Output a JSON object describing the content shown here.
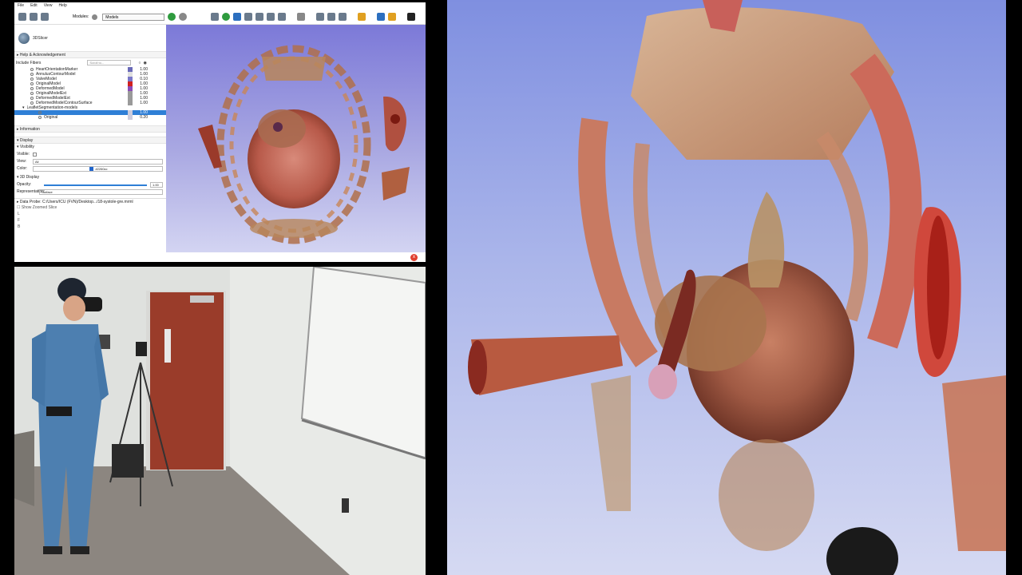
{
  "menu": [
    "File",
    "Edit",
    "View",
    "Help"
  ],
  "toolbar": {
    "modules_label": "Modules:",
    "module_selected": "Models"
  },
  "app": {
    "name": "3DSlicer"
  },
  "sections": {
    "help": "Help & Acknowledgement",
    "information": "Information",
    "display": "Display",
    "visibility": "Visibility",
    "display3d": "3D Display"
  },
  "filter": {
    "label": "Include Fibers",
    "placeholder": "Scroll to..."
  },
  "models": [
    {
      "name": "HeartOrientationMarker",
      "opacity": "1.00",
      "color": "#6a6ab8"
    },
    {
      "name": "AnnulusContourModel",
      "opacity": "1.00",
      "color": "#e0e0e0"
    },
    {
      "name": "ValveModel",
      "opacity": "0.10",
      "color": "#7a78c8"
    },
    {
      "name": "OriginalModel",
      "opacity": "1.00",
      "color": "#d02020"
    },
    {
      "name": "DeformedModel",
      "opacity": "1.00",
      "color": "#8a4bb8"
    },
    {
      "name": "OriginalModelExt",
      "opacity": "1.00",
      "color": "#9a9a9a"
    },
    {
      "name": "DeformedModelExt",
      "opacity": "1.00",
      "color": "#9a9a9a"
    },
    {
      "name": "DeformedModelContourSurface",
      "opacity": "1.00",
      "color": "#9a9a9a"
    }
  ],
  "group": {
    "name": "LeafletSegmentation-models"
  },
  "group_children": [
    {
      "name": "",
      "opacity": "1.00",
      "selected": true
    },
    {
      "name": "Original",
      "opacity": "0.20",
      "selected": false
    }
  ],
  "visibility": {
    "visible_label": "Visible:",
    "view_label": "View:",
    "view_value": "All",
    "color_label": "Color:",
    "color_value": "#2260cc"
  },
  "display3d": {
    "opacity_label": "Opacity:",
    "opacity_value": "1.00",
    "representation_label": "Representation:",
    "representation_value": "Surface"
  },
  "probe": {
    "label": "Data Probe:",
    "path": "C:/Users/ICU (FVN)/Desktop.../18-systole-gre.mrml"
  },
  "slice": {
    "label": "Show Zoomed Slice",
    "l": "L",
    "f": "F",
    "b": "B"
  },
  "status": {
    "error_icon": "x"
  }
}
